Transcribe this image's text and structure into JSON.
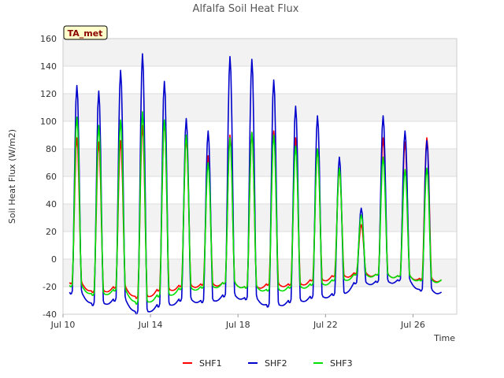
{
  "chart_data": {
    "type": "line",
    "title": "Alfalfa Soil Heat Flux",
    "xlabel": "Time",
    "ylabel": "Soil Heat Flux (W/m2)",
    "badge": "TA_met",
    "ylim": [
      -40,
      160
    ],
    "yticks": [
      -40,
      -20,
      0,
      20,
      40,
      60,
      80,
      100,
      120,
      140,
      160
    ],
    "xlim": [
      10,
      28
    ],
    "xticks": [
      {
        "value": 10,
        "label": "Jul 10"
      },
      {
        "value": 14,
        "label": "Jul 14"
      },
      {
        "value": 18,
        "label": "Jul 18"
      },
      {
        "value": 22,
        "label": "Jul 22"
      },
      {
        "value": 26,
        "label": "Jul 26"
      }
    ],
    "grid": true,
    "legend_position": "bottom",
    "daily_start_day": 10.3,
    "series": [
      {
        "name": "SHF1",
        "color": "#ff0000",
        "daily_peaks": [
          88,
          85,
          86,
          97,
          100,
          88,
          75,
          90,
          92,
          93,
          88,
          80,
          65,
          25,
          88,
          85,
          88
        ],
        "daily_troughs": [
          -17,
          -23,
          -20,
          -27,
          -22,
          -19,
          -18,
          -17,
          -20,
          -18,
          -18,
          -15,
          -12,
          -10,
          -11,
          -12,
          -14,
          -15
        ]
      },
      {
        "name": "SHF2",
        "color": "#0000cc",
        "daily_peaks": [
          126,
          122,
          137,
          149,
          129,
          102,
          93,
          147,
          145,
          130,
          111,
          104,
          74,
          37,
          104,
          93,
          86
        ],
        "daily_troughs": [
          -24,
          -32,
          -29,
          -38,
          -33,
          -29,
          -30,
          -26,
          -28,
          -33,
          -30,
          -27,
          -25,
          -17,
          -16,
          -15,
          -22,
          -24
        ]
      },
      {
        "name": "SHF3",
        "color": "#00e000",
        "daily_peaks": [
          103,
          97,
          101,
          107,
          101,
          90,
          70,
          88,
          92,
          90,
          82,
          80,
          66,
          32,
          74,
          65,
          66
        ],
        "daily_troughs": [
          -19,
          -25,
          -22,
          -31,
          -26,
          -21,
          -20,
          -17,
          -20,
          -22,
          -20,
          -18,
          -15,
          -11,
          -11,
          -12,
          -15,
          -15
        ]
      }
    ]
  }
}
